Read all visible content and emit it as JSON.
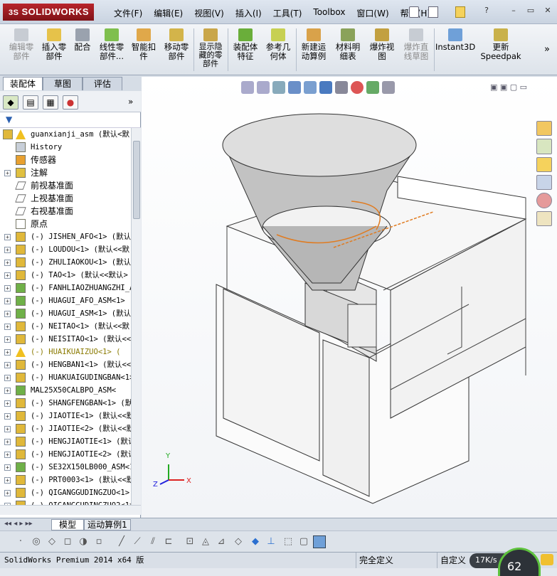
{
  "app": {
    "logo_text": "SOLIDWORKS",
    "logo_prefix": "3S"
  },
  "menu": [
    "文件(F)",
    "编辑(E)",
    "视图(V)",
    "插入(I)",
    "工具(T)",
    "Toolbox",
    "窗口(W)",
    "帮助(H)"
  ],
  "commands": [
    {
      "label": "编辑零\n部件",
      "icon": "edit-component-icon",
      "disabled": true
    },
    {
      "label": "插入零\n部件",
      "icon": "insert-component-icon",
      "disabled": false
    },
    {
      "label": "配合",
      "icon": "mate-icon",
      "disabled": false
    },
    {
      "label": "线性零\n部件...",
      "icon": "linear-pattern-icon",
      "disabled": false
    },
    {
      "label": "智能扣\n件",
      "icon": "smart-fastener-icon",
      "disabled": false
    },
    {
      "label": "移动零\n部件",
      "icon": "move-component-icon",
      "disabled": false
    },
    {
      "label": "显示隐\n藏的零\n部件",
      "icon": "show-hidden-icon",
      "disabled": false
    },
    {
      "label": "装配体\n特征",
      "icon": "assembly-feature-icon",
      "disabled": false
    },
    {
      "label": "参考几\n何体",
      "icon": "reference-geometry-icon",
      "disabled": false
    },
    {
      "label": "新建运\n动算例",
      "icon": "motion-study-icon",
      "disabled": false
    },
    {
      "label": "材料明\n细表",
      "icon": "bom-icon",
      "disabled": false
    },
    {
      "label": "爆炸视\n图",
      "icon": "exploded-view-icon",
      "disabled": false
    },
    {
      "label": "爆炸直\n线草图",
      "icon": "explode-line-icon",
      "disabled": true
    },
    {
      "label": "Instant3D",
      "icon": "instant3d-icon",
      "disabled": false
    },
    {
      "label": "更新\nSpeedpak",
      "icon": "speedpak-icon",
      "disabled": false
    }
  ],
  "top_tabs": [
    "装配体",
    "草图",
    "评估"
  ],
  "tree": {
    "root": "guanxianji_asm  (默认<默",
    "items": [
      {
        "label": "History",
        "icon": "history-icon",
        "expand": false,
        "cn": false
      },
      {
        "label": "传感器",
        "icon": "sensor-icon",
        "expand": false,
        "cn": true
      },
      {
        "label": "注解",
        "icon": "annotation-icon",
        "expand": true,
        "cn": true
      },
      {
        "label": "前视基准面",
        "icon": "plane-icon",
        "expand": false,
        "cn": true
      },
      {
        "label": "上视基准面",
        "icon": "plane-icon",
        "expand": false,
        "cn": true
      },
      {
        "label": "右视基准面",
        "icon": "plane-icon",
        "expand": false,
        "cn": true
      },
      {
        "label": "原点",
        "icon": "origin-icon",
        "expand": false,
        "cn": true
      },
      {
        "label": "(-) JISHEN_AFO<1> (默认",
        "icon": "part-icon",
        "expand": true,
        "cn": false
      },
      {
        "label": "(-) LOUDOU<1> (默认<<默",
        "icon": "part-icon",
        "expand": true,
        "cn": false
      },
      {
        "label": "(-) ZHULIAOKOU<1> (默认",
        "icon": "part-icon",
        "expand": true,
        "cn": false
      },
      {
        "label": "(-) TAO<1> (默认<<默认>",
        "icon": "part-icon",
        "expand": true,
        "cn": false
      },
      {
        "label": "(-) FANHLIAOZHUANGZHI_A",
        "icon": "subasm-icon",
        "expand": true,
        "cn": false
      },
      {
        "label": "(-) HUAGUI_AFO_ASM<1> (",
        "icon": "subasm-icon",
        "expand": true,
        "cn": false
      },
      {
        "label": "(-) HUAGUI_ASM<1> (默认",
        "icon": "subasm-icon",
        "expand": true,
        "cn": false
      },
      {
        "label": "(-) NEITAO<1> (默认<<默",
        "icon": "part-icon",
        "expand": true,
        "cn": false
      },
      {
        "label": "(-) NEISITAO<1> (默认<<",
        "icon": "part-icon",
        "expand": true,
        "cn": false
      },
      {
        "label": "(-) HUAIKUAIZUO<1> (",
        "icon": "warning-icon",
        "expand": true,
        "cn": false,
        "warn": true
      },
      {
        "label": "(-) HENGBAN1<1> (默认<<",
        "icon": "part-icon",
        "expand": true,
        "cn": false
      },
      {
        "label": "(-) HUAKUAIGUDINGBAN<1>",
        "icon": "part-icon",
        "expand": true,
        "cn": false
      },
      {
        "label": "MAL25X50CALBPO_ASM<",
        "icon": "subasm-icon",
        "expand": true,
        "cn": false
      },
      {
        "label": "(-) SHANGFENGBAN<1> (默",
        "icon": "part-icon",
        "expand": true,
        "cn": false
      },
      {
        "label": "(-) JIAOTIE<1> (默认<<默",
        "icon": "part-icon",
        "expand": true,
        "cn": false
      },
      {
        "label": "(-) JIAOTIE<2> (默认<<默",
        "icon": "part-icon",
        "expand": true,
        "cn": false
      },
      {
        "label": "(-) HENGJIAOTIE<1> (默认",
        "icon": "part-icon",
        "expand": true,
        "cn": false
      },
      {
        "label": "(-) HENGJIAOTIE<2> (默认",
        "icon": "part-icon",
        "expand": true,
        "cn": false
      },
      {
        "label": "(-) SE32X150LB000_ASM<1",
        "icon": "subasm-icon",
        "expand": true,
        "cn": false
      },
      {
        "label": "(-) PRT0003<1> (默认<<默",
        "icon": "part-icon",
        "expand": true,
        "cn": false
      },
      {
        "label": "(-) QIGANGGUDINGZUO<1>",
        "icon": "part-icon",
        "expand": true,
        "cn": false
      },
      {
        "label": "(-) QIGANGGUDINGZUO2<1>",
        "icon": "part-icon",
        "expand": true,
        "cn": false
      }
    ]
  },
  "bottom_tabs": [
    "模型",
    "运动算例1"
  ],
  "status": {
    "left": "SolidWorks Premium 2014 x64 版",
    "constraint": "完全定义",
    "custom": "自定义",
    "speed": "17K/s",
    "gauge": "62"
  },
  "axis": {
    "x": "X",
    "y": "Y",
    "z": "Z"
  },
  "colors": {
    "accent_red": "#b8252c",
    "highlight_orange": "#e07b20",
    "gauge_green": "#5ec23d"
  }
}
